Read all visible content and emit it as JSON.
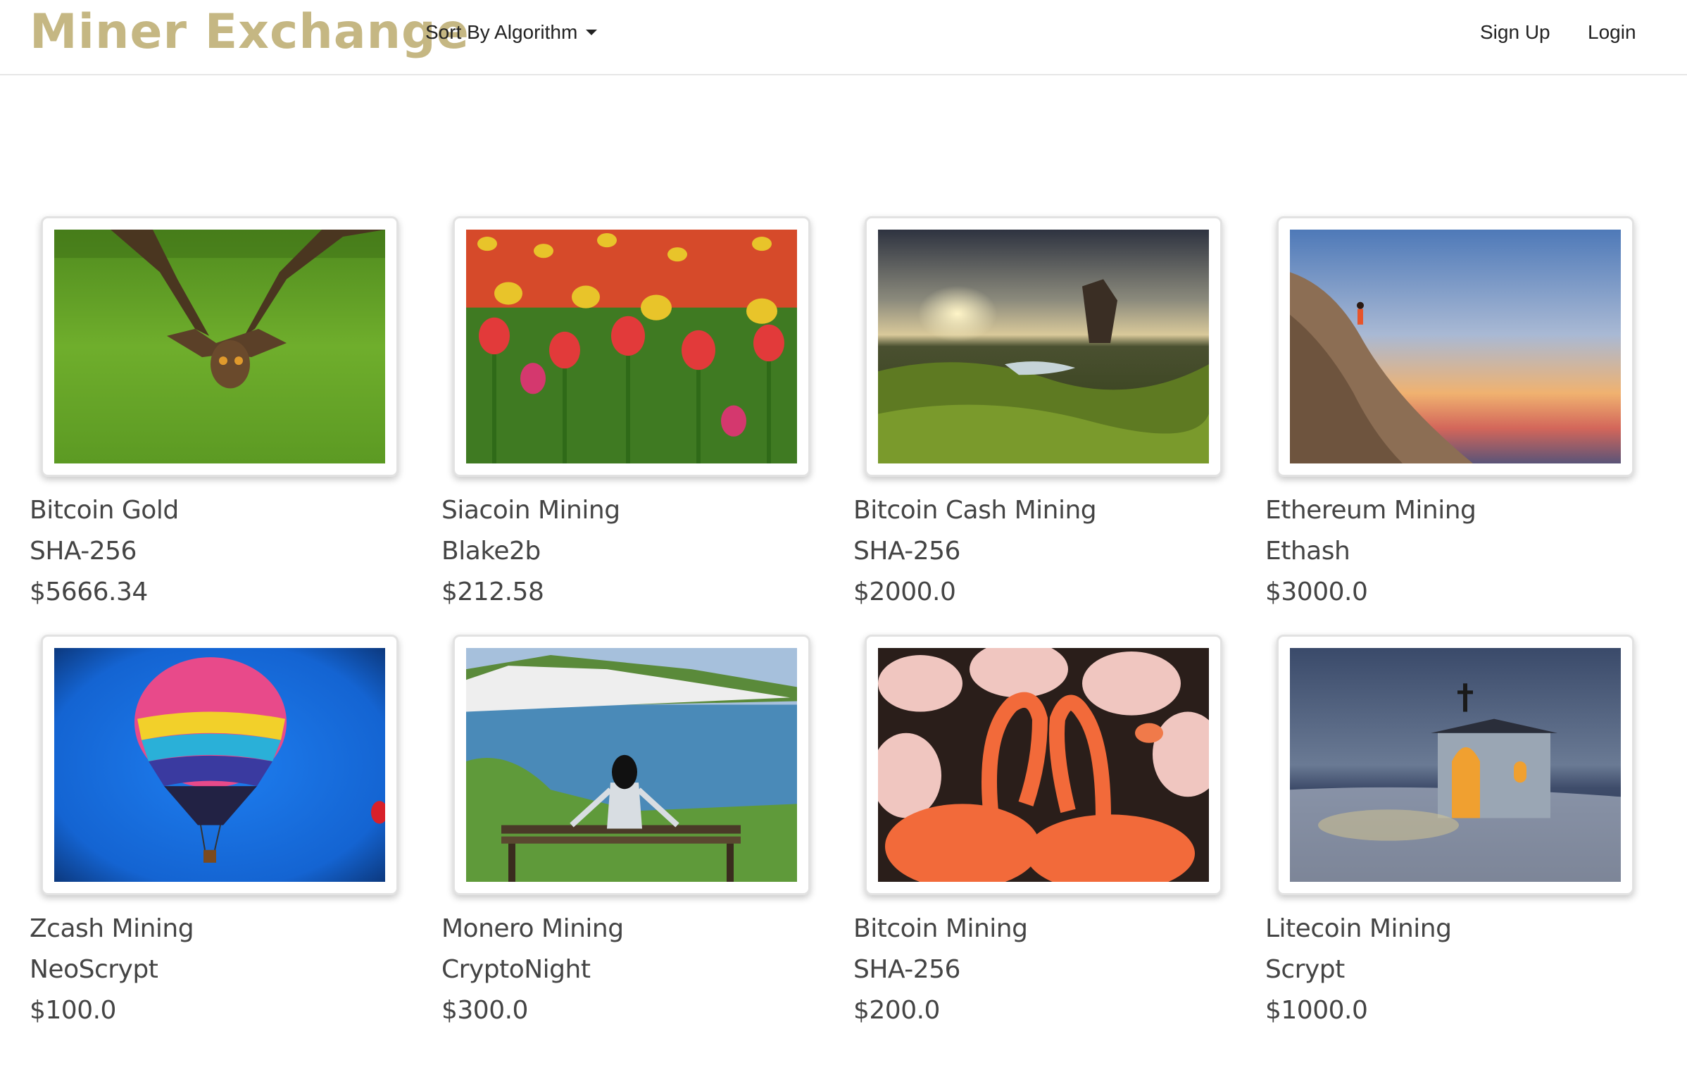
{
  "brand": "Miner Exchange",
  "nav": {
    "sort_label": "Sort By Algorithm",
    "signup": "Sign Up",
    "login": "Login"
  },
  "listings": [
    {
      "title": "Bitcoin Gold",
      "algorithm": "SHA-256",
      "price": "$5666.34",
      "image": "owl-photo"
    },
    {
      "title": "Siacoin Mining",
      "algorithm": "Blake2b",
      "price": "$212.58",
      "image": "tulips-photo"
    },
    {
      "title": "Bitcoin Cash Mining",
      "algorithm": "SHA-256",
      "price": "$2000.0",
      "image": "mossy-coast-photo"
    },
    {
      "title": "Ethereum Mining",
      "algorithm": "Ethash",
      "price": "$3000.0",
      "image": "cliff-climber-photo"
    },
    {
      "title": "Zcash Mining",
      "algorithm": "NeoScrypt",
      "price": "$100.0",
      "image": "hot-air-balloon-photo"
    },
    {
      "title": "Monero Mining",
      "algorithm": "CryptoNight",
      "price": "$300.0",
      "image": "white-cliffs-bench-photo"
    },
    {
      "title": "Bitcoin Mining",
      "algorithm": "SHA-256",
      "price": "$200.0",
      "image": "flamingos-photo"
    },
    {
      "title": "Litecoin Mining",
      "algorithm": "Scrypt",
      "price": "$1000.0",
      "image": "snow-chapel-photo"
    }
  ],
  "colors": {
    "brand": "#c5b783",
    "text": "#444444",
    "border": "#e2e2e2"
  }
}
